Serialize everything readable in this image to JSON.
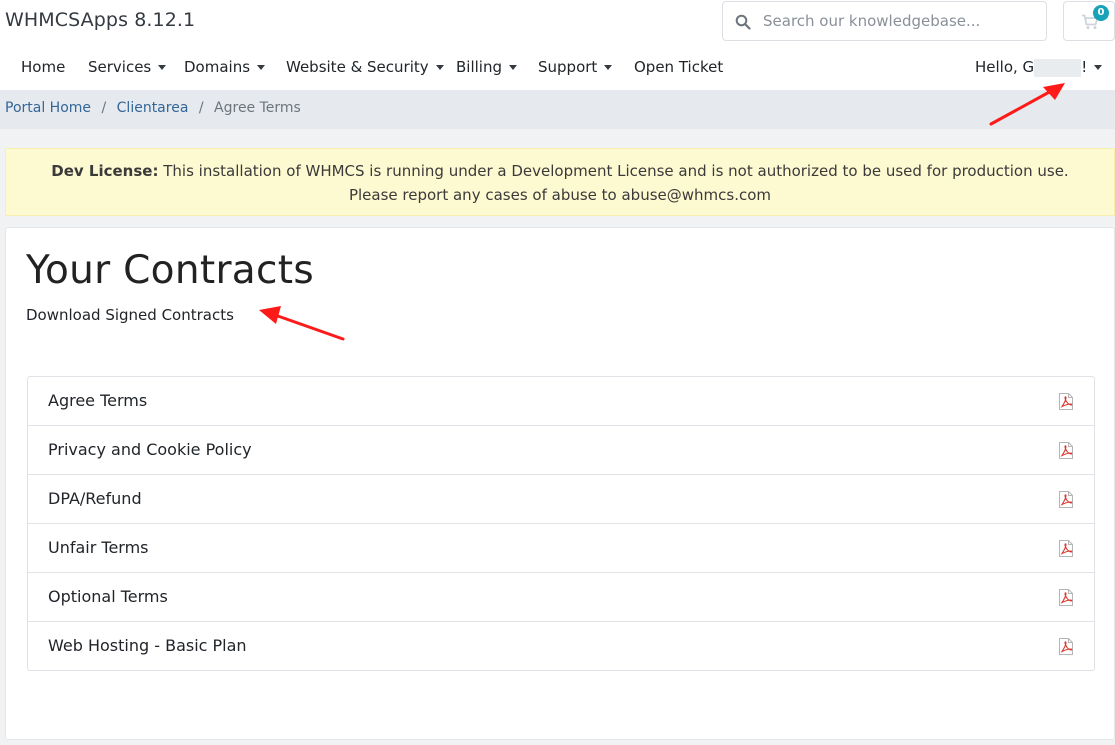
{
  "header": {
    "brand": "WHMCSApps 8.12.1",
    "search_placeholder": "Search our knowledgebase...",
    "cart_count": "0"
  },
  "nav": {
    "items": [
      {
        "label": "Home",
        "dropdown": false
      },
      {
        "label": "Services",
        "dropdown": true
      },
      {
        "label": "Domains",
        "dropdown": true
      },
      {
        "label": "Website & Security",
        "dropdown": true
      },
      {
        "label": "Billing",
        "dropdown": true
      },
      {
        "label": "Support",
        "dropdown": true
      },
      {
        "label": "Open Ticket",
        "dropdown": false
      }
    ],
    "user_greeting_start": "Hello, G",
    "user_greeting_end": "!"
  },
  "breadcrumb": {
    "items": [
      "Portal Home",
      "Clientarea"
    ],
    "active": "Agree Terms",
    "separator": "/"
  },
  "alert": {
    "label": "Dev License:",
    "line1": "This installation of WHMCS is running under a Development License and is not authorized to be used for production use.",
    "line2": "Please report any cases of abuse to abuse@whmcs.com"
  },
  "main": {
    "title": "Your Contracts",
    "subtitle": "Download Signed Contracts",
    "contracts": [
      {
        "label": "Agree Terms"
      },
      {
        "label": "Privacy and Cookie Policy"
      },
      {
        "label": "DPA/Refund"
      },
      {
        "label": "Unfair Terms"
      },
      {
        "label": "Optional Terms"
      },
      {
        "label": "Web Hosting - Basic Plan"
      }
    ]
  },
  "icons": {
    "search": "search-icon",
    "cart": "shopping-cart-icon",
    "pdf": "file-pdf-icon",
    "caret": "caret-down-icon"
  },
  "colors": {
    "link": "#336699",
    "alert_bg": "#fdf9d0",
    "badge": "#17a2b8",
    "pdf": "#d9382f",
    "annotation": "#ff1a1a"
  }
}
